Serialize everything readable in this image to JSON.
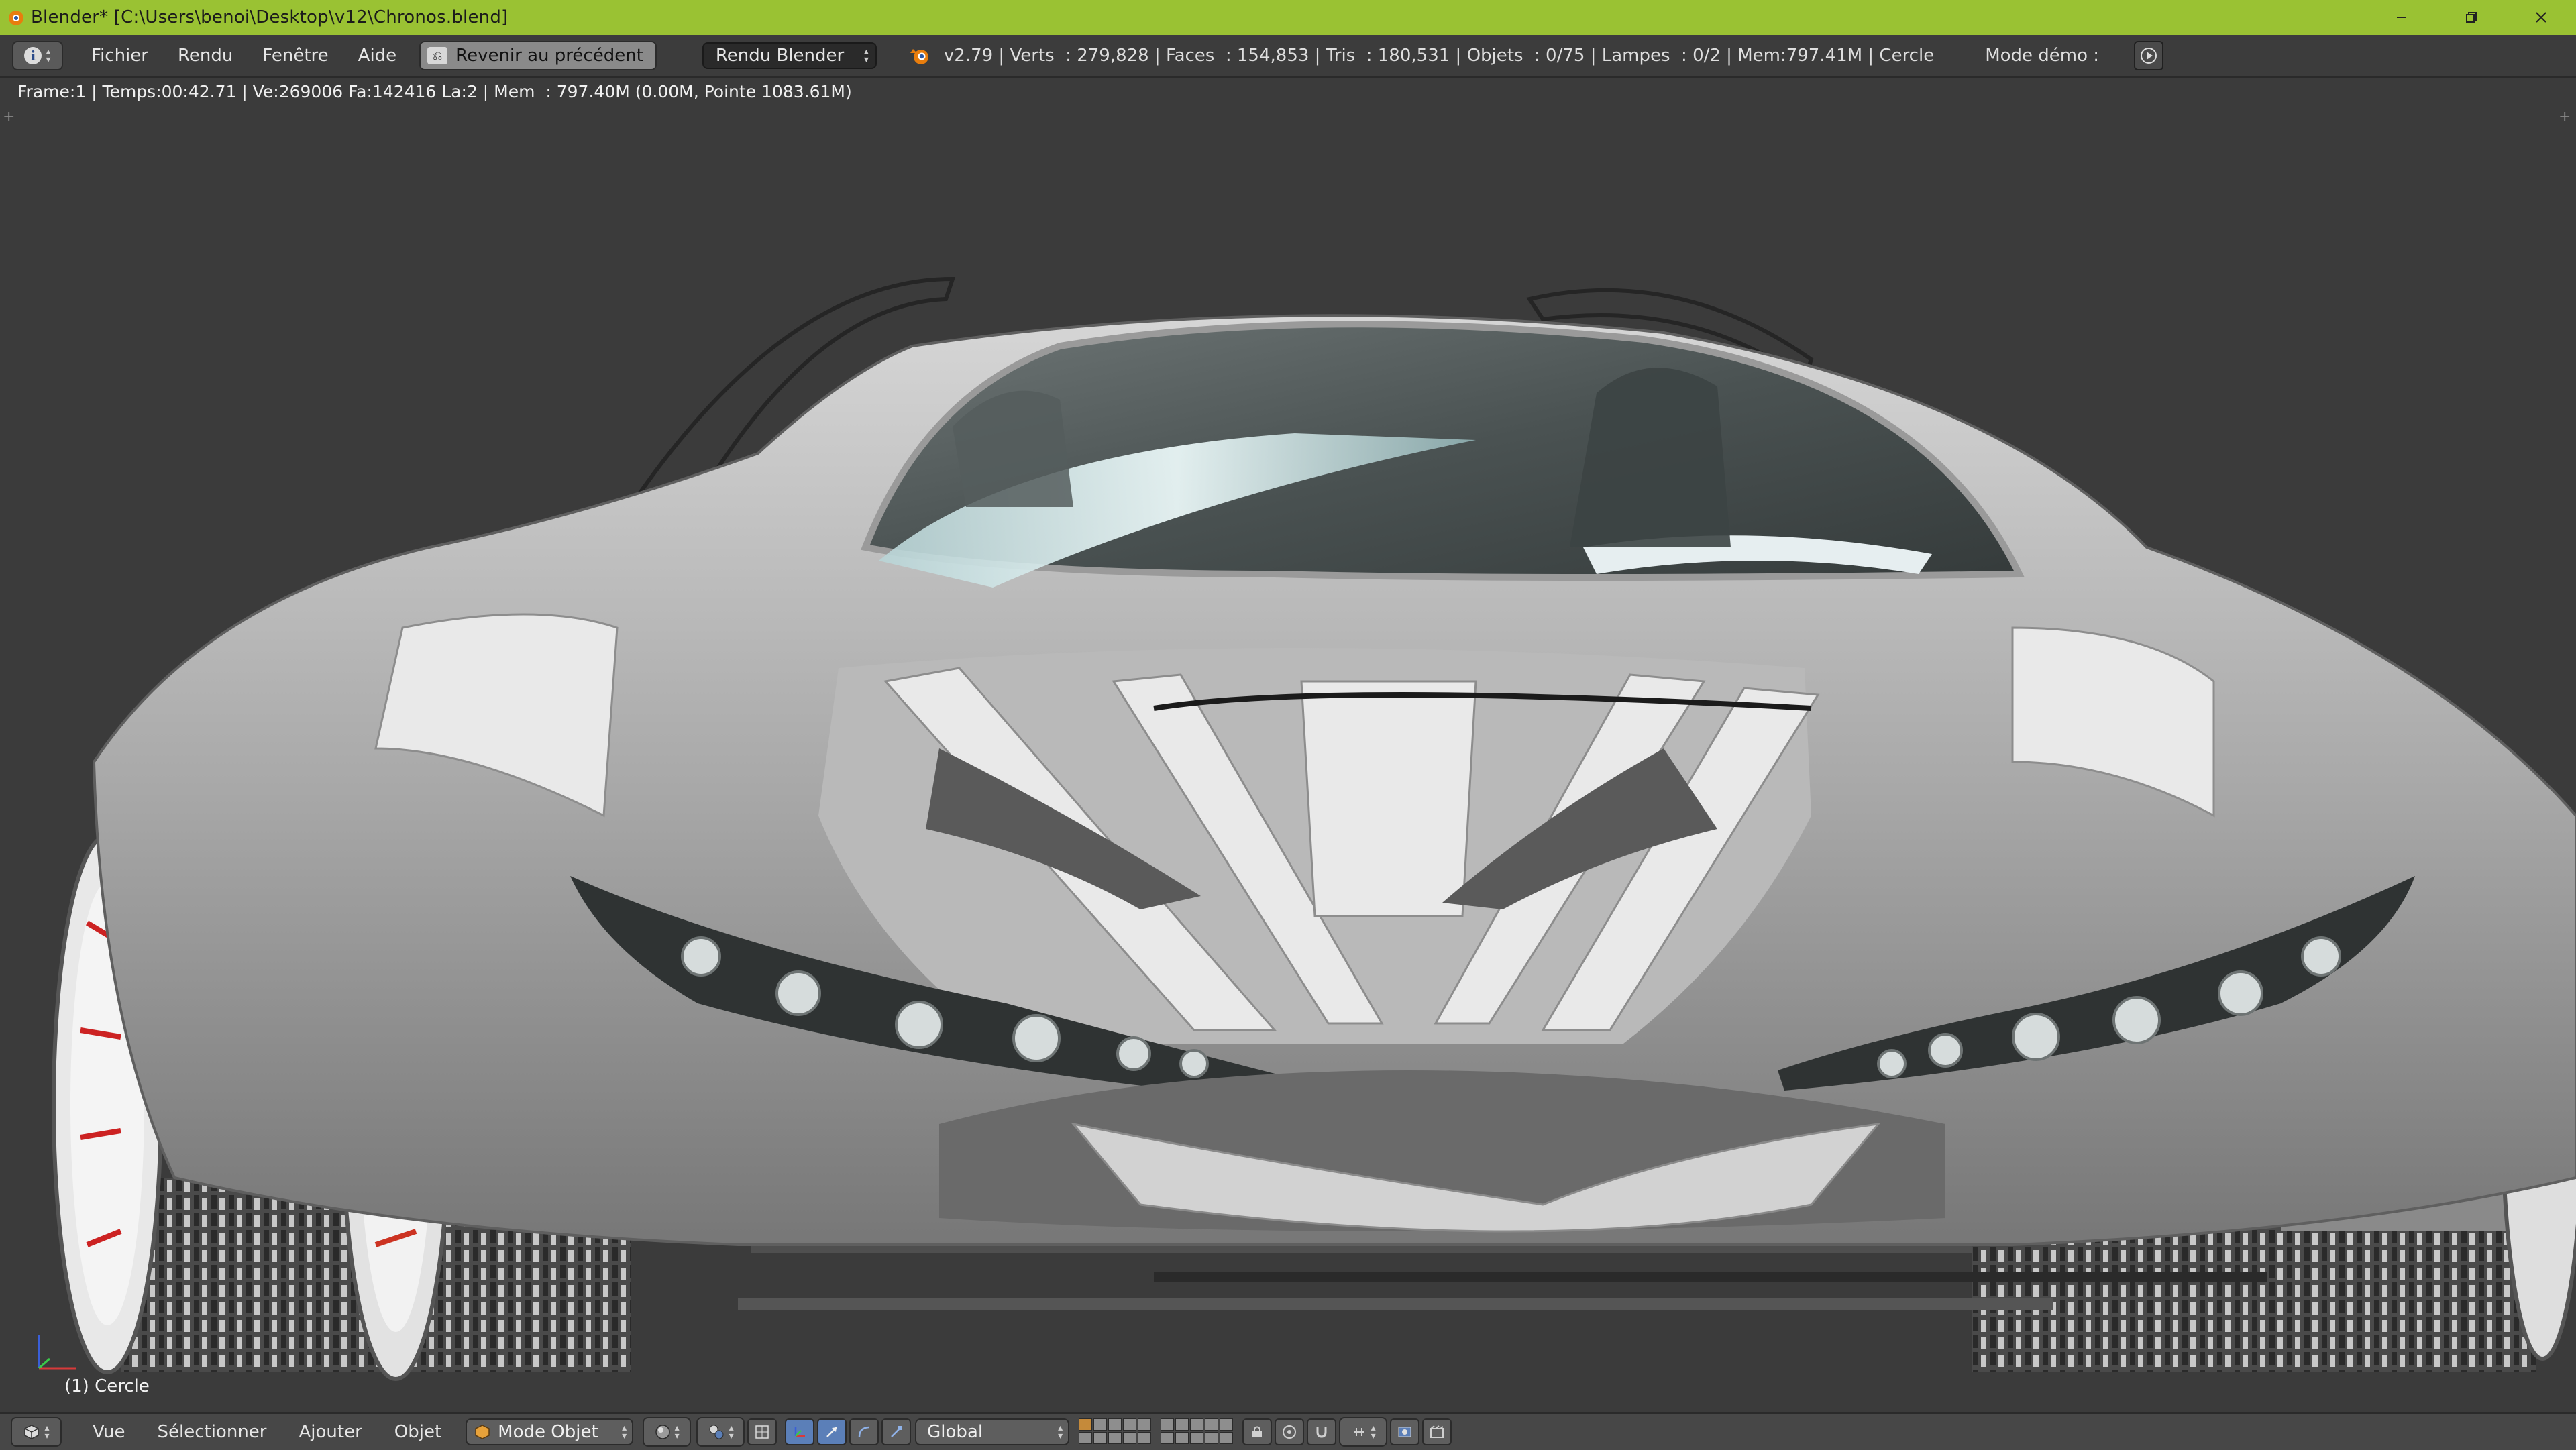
{
  "window": {
    "title": "Blender* [C:\\Users\\benoi\\Desktop\\v12\\Chronos.blend]",
    "controls": [
      "minimize-icon",
      "restore-icon",
      "close-icon"
    ]
  },
  "header": {
    "menus": [
      "Fichier",
      "Rendu",
      "Fenêtre",
      "Aide"
    ],
    "revert_label": "Revenir au précédent",
    "render_engine": "Rendu Blender",
    "stats": "v2.79 | Verts  : 279,828 | Faces  : 154,853 | Tris  : 180,531 | Objets  : 0/75 | Lampes  : 0/2 | Mem:797.41M | Cercle",
    "demo_label": "Mode démo  :"
  },
  "viewport": {
    "render_info": "Frame:1 | Temps:00:42.71 | Ve:269006 Fa:142416 La:2 | Mem  : 797.40M (0.00M, Pointe 1083.61M)",
    "active_object": "(1) Cercle"
  },
  "footer": {
    "menus": [
      "Vue",
      "Sélectionner",
      "Ajouter",
      "Objet"
    ],
    "mode": "Mode Objet",
    "orientation": "Global"
  },
  "colors": {
    "titlebar": "#9ac233",
    "header_bg": "#3c3c3c",
    "viewport_bg": "#3b3b3b",
    "accent_blue": "#5b7fb8",
    "wheel_accent": "#cc2222"
  }
}
